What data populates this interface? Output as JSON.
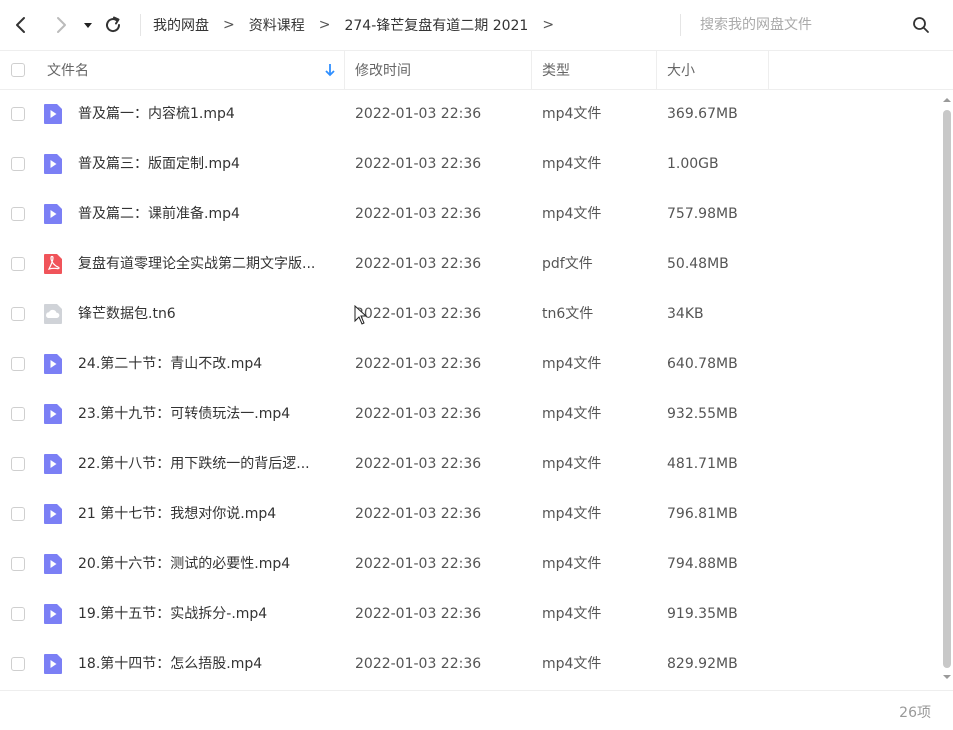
{
  "toolbar": {
    "breadcrumbs": [
      "我的网盘",
      "资料课程",
      "274-锋芒复盘有道二期 2021"
    ],
    "separator": ">",
    "search_placeholder": "搜索我的网盘文件"
  },
  "table": {
    "headers": {
      "name": "文件名",
      "modified": "修改时间",
      "type": "类型",
      "size": "大小"
    },
    "rows": [
      {
        "name": "普及篇一：内容梳1.mp4",
        "modified": "2022-01-03 22:36",
        "type": "mp4文件",
        "size": "369.67MB",
        "icon": "video-file-icon"
      },
      {
        "name": "普及篇三：版面定制.mp4",
        "modified": "2022-01-03 22:36",
        "type": "mp4文件",
        "size": "1.00GB",
        "icon": "video-file-icon"
      },
      {
        "name": "普及篇二：课前准备.mp4",
        "modified": "2022-01-03 22:36",
        "type": "mp4文件",
        "size": "757.98MB",
        "icon": "video-file-icon"
      },
      {
        "name": "复盘有道零理论全实战第二期文字版...",
        "modified": "2022-01-03 22:36",
        "type": "pdf文件",
        "size": "50.48MB",
        "icon": "pdf-file-icon"
      },
      {
        "name": "锋芒数据包.tn6",
        "modified": "2022-01-03 22:36",
        "type": "tn6文件",
        "size": "34KB",
        "icon": "generic-file-icon"
      },
      {
        "name": "24.第二十节：青山不改.mp4",
        "modified": "2022-01-03 22:36",
        "type": "mp4文件",
        "size": "640.78MB",
        "icon": "video-file-icon"
      },
      {
        "name": "23.第十九节：可转债玩法一.mp4",
        "modified": "2022-01-03 22:36",
        "type": "mp4文件",
        "size": "932.55MB",
        "icon": "video-file-icon"
      },
      {
        "name": "22.第十八节：用下跌统一的背后逻...",
        "modified": "2022-01-03 22:36",
        "type": "mp4文件",
        "size": "481.71MB",
        "icon": "video-file-icon"
      },
      {
        "name": "21 第十七节：我想对你说.mp4",
        "modified": "2022-01-03 22:36",
        "type": "mp4文件",
        "size": "796.81MB",
        "icon": "video-file-icon"
      },
      {
        "name": "20.第十六节：测试的必要性.mp4",
        "modified": "2022-01-03 22:36",
        "type": "mp4文件",
        "size": "794.88MB",
        "icon": "video-file-icon"
      },
      {
        "name": "19.第十五节：实战拆分-.mp4",
        "modified": "2022-01-03 22:36",
        "type": "mp4文件",
        "size": "919.35MB",
        "icon": "video-file-icon"
      },
      {
        "name": "18.第十四节：怎么捂股.mp4",
        "modified": "2022-01-03 22:36",
        "type": "mp4文件",
        "size": "829.92MB",
        "icon": "video-file-icon"
      }
    ]
  },
  "footer": {
    "item_count": "26项"
  },
  "colors": {
    "video_icon": "#7b7ff5",
    "pdf_icon": "#f0545a",
    "generic_icon": "#d0d3d8",
    "sort_arrow": "#2f8fff"
  }
}
